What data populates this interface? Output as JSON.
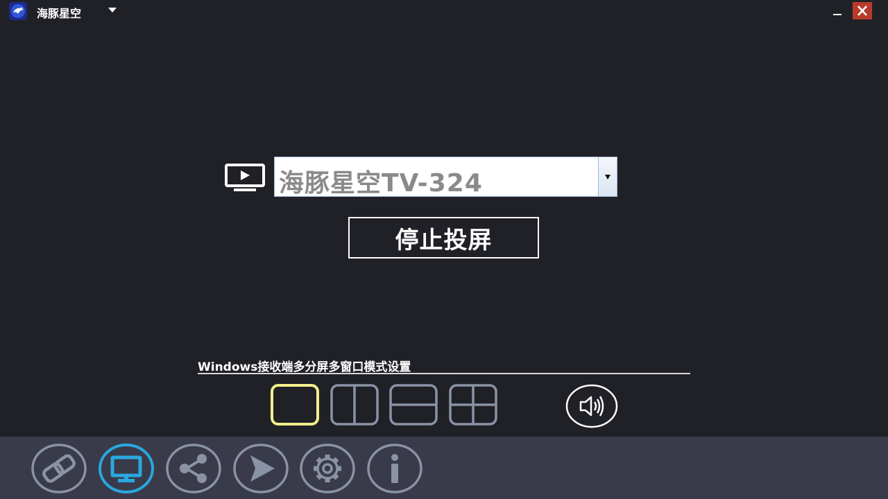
{
  "window": {
    "title": "海豚星空"
  },
  "device": {
    "selected": "海豚星空TV-324"
  },
  "stop_button": {
    "label": "停止投屏"
  },
  "multiwindow": {
    "label": "Windows接收端多分屏多窗口模式设置",
    "selected_layout": "single"
  },
  "nav": {
    "items": [
      "link",
      "screen",
      "share",
      "send",
      "settings",
      "info"
    ],
    "active": "screen"
  },
  "colors": {
    "background": "#202127",
    "bottom_bar": "#3a3b4a",
    "accent_blue": "#29a8e0",
    "highlight_yellow": "#f3ef8a",
    "close_red": "#b83b2a"
  }
}
